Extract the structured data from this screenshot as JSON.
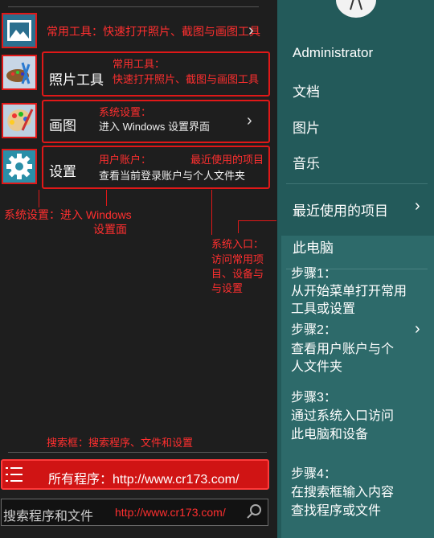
{
  "left": {
    "row1_label": "常用工具：快速打开照片、截图与画图工具",
    "photo_tool": "照片工具",
    "photo_note_1": "常用工具：",
    "photo_note_2": "快速打开照片、截图与画图工具",
    "paint": "画图",
    "paint_note_1": "系统设置：",
    "paint_note_2": "进入 Windows 设置界面",
    "settings": "设置",
    "settings_note_1": "用户账户：",
    "settings_note_2": "查看当前登录账户与个人文件夹",
    "settings_note_3": "最近使用的项目",
    "callout_1": "系统设置：进入 Windows",
    "callout_2": "设置面",
    "callout_3": "系统入口：",
    "callout_4": "访问常用项",
    "callout_5": "目、设备与",
    "callout_6": "与设置",
    "search_note": "搜索框：搜索程序、文件和设置",
    "all_programs": "所有程序：http://www.cr173.com/",
    "search_placeholder": "搜索程序和文件",
    "search_url": "http://www.cr173.com/"
  },
  "right": {
    "user": "Administrator",
    "documents": "文档",
    "pictures": "图片",
    "music": "音乐",
    "recent": "最近使用的项目",
    "computer": "此电脑",
    "step1_a": "步骤1：",
    "step1_b": "从开始菜单打开常用",
    "step1_c": "工具或设置",
    "step2_a": "步骤2：",
    "step2_b": "查看用户账户与个",
    "step2_c": "人文件夹",
    "step3_a": "步骤3：",
    "step3_b": "通过系统入口访问",
    "step3_c": "此电脑和设备",
    "step4_a": "步骤4：",
    "step4_b": "在搜索框输入内容",
    "step4_c": "查找程序或文件"
  },
  "colors": {
    "accent_red": "#e01818",
    "right_panel": "#235a5a",
    "left_panel": "#1e1e1e"
  }
}
